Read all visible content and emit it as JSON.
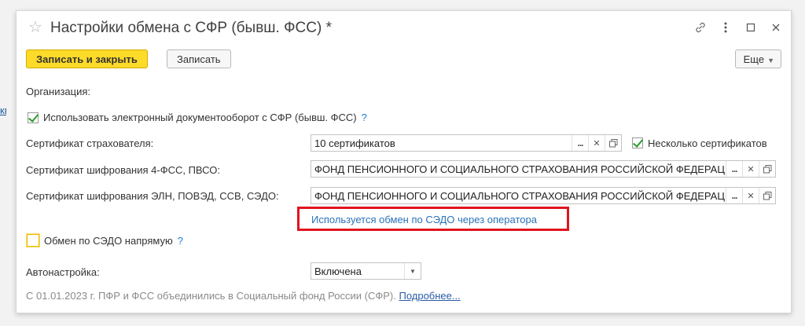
{
  "edge_link": "квизиты",
  "window": {
    "title": "Настройки обмена с СФР (бывш. ФСС) *"
  },
  "toolbar": {
    "save_close_label": "Записать и закрыть",
    "save_label": "Записать",
    "more_label": "Еще"
  },
  "form": {
    "organization_label": "Организация:",
    "use_edo_label": "Использовать электронный документооборот с СФР (бывш. ФСС)",
    "use_edo_checked": true,
    "help_mark": "?",
    "insurer_cert_label": "Сертификат страхователя:",
    "insurer_cert_value": "10 сертификатов",
    "multi_certs_label": "Несколько сертификатов",
    "multi_certs_checked": true,
    "enc_cert_4fss_label": "Сертификат шифрования 4-ФСС, ПВСО:",
    "enc_cert_4fss_value": "ФОНД ПЕНСИОННОГО И СОЦИАЛЬНОГО СТРАХОВАНИЯ РОССИЙСКОЙ ФЕДЕРАЦИИ",
    "enc_cert_eln_label": "Сертификат шифрования ЭЛН, ПОВЭД, ССВ, СЭДО:",
    "enc_cert_eln_value": "ФОНД ПЕНСИОННОГО И СОЦИАЛЬНОГО СТРАХОВАНИЯ РОССИЙСКОЙ ФЕДЕРАЦИИ",
    "sedo_operator_link": "Используется обмен по СЭДО через оператора",
    "sedo_direct_label": "Обмен по СЭДО напрямую",
    "sedo_direct_checked": false,
    "autoconfig_label": "Автонастройка:",
    "autoconfig_value": "Включена"
  },
  "footer": {
    "note": "С 01.01.2023 г. ПФР и ФСС объединились в Социальный фонд России (СФР). ",
    "more_link": "Подробнее..."
  },
  "icons": {
    "star": "star-icon",
    "link": "link-icon",
    "menu": "kebab-menu-icon",
    "maximize": "maximize-icon",
    "close": "close-icon"
  },
  "colors": {
    "primary_button": "#ffdb29",
    "highlight_border": "#e0141e",
    "link": "#2a72b8",
    "check": "#2b9b2b"
  }
}
